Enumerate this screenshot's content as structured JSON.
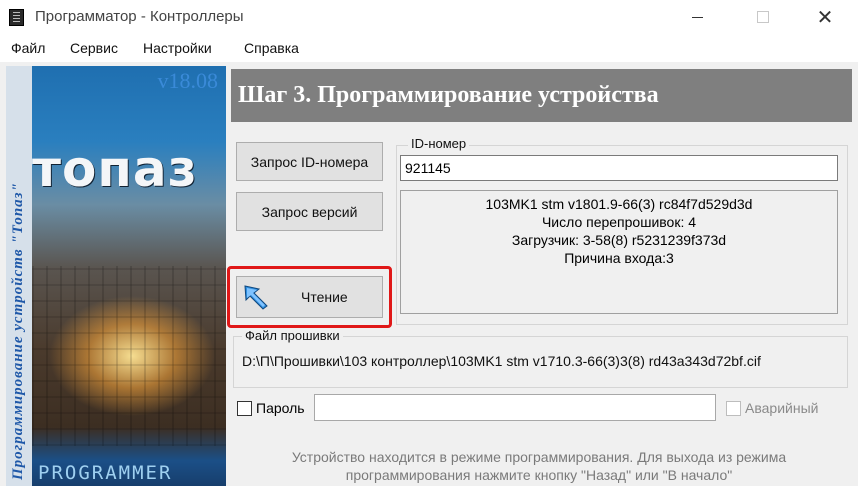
{
  "window": {
    "title": "Программатор - Контроллеры",
    "close": "✕"
  },
  "menu": [
    "Файл",
    "Сервис",
    "Настройки",
    "Справка"
  ],
  "sidebar": {
    "vertical_text": "Программирование  устройств  \"Топаз\"",
    "version": "v18.08",
    "brand": "топаз",
    "footer": "PROGRAMMER"
  },
  "step": {
    "title": "Шаг 3. Программирование устройства"
  },
  "buttons": {
    "request_id": "Запрос ID-номера",
    "request_versions": "Запрос версий",
    "read": "Чтение"
  },
  "id_group": {
    "label": "ID-номер",
    "value": "921145",
    "info": [
      "103MK1 stm v1801.9-66(3) rc84f7d529d3d",
      "Число перепрошивок: 4",
      "Загрузчик: 3-58(8) r5231239f373d",
      "Причина входа:3"
    ]
  },
  "firmware": {
    "label": "Файл прошивки",
    "path": "D:\\П\\Прошивки\\103 контроллер\\103MK1 stm v1710.3-66(3)3(8) rd43a343d72bf.cif"
  },
  "password": {
    "label": "Пароль",
    "value": "",
    "checked": false
  },
  "emergency": {
    "label": "Аварийный",
    "checked": false,
    "enabled": false
  },
  "status": {
    "line1": "Устройство находится в режиме программирования. Для выхода из режима",
    "line2": "программирования нажмите кнопку \"Назад\" или \"В начало\""
  },
  "icons": {
    "app": "app-icon",
    "read": "arrow-cursor-icon"
  },
  "colors": {
    "highlight": "#e01818",
    "header_bg": "#7f7f7f"
  }
}
